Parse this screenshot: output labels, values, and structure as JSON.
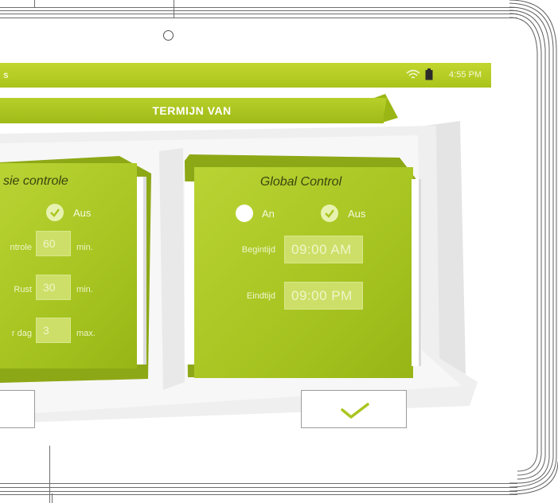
{
  "status_bar": {
    "left_text": "s",
    "time": "4:55 PM",
    "icons": [
      "wifi-icon",
      "battery-icon"
    ]
  },
  "ribbon": {
    "title": "TERMIJN VAN"
  },
  "left_card": {
    "title": "sie controle",
    "options": {
      "on_label": "",
      "off_label": "Aus",
      "selected": "Aus"
    },
    "rows": [
      {
        "label": "ntrole",
        "value": "60",
        "unit": "min."
      },
      {
        "label": "Rust",
        "value": "30",
        "unit": "min."
      },
      {
        "label": "r dag",
        "value": "3",
        "unit": "max."
      }
    ]
  },
  "right_card": {
    "title": "Global Control",
    "options": {
      "on_label": "An",
      "off_label": "Aus",
      "selected": "Aus"
    },
    "rows": [
      {
        "label": "Begintijd",
        "value": "09:00 AM"
      },
      {
        "label": "Eindtijd",
        "value": "09:00 PM"
      }
    ]
  },
  "actions": {
    "confirm_icon": "checkmark-icon"
  },
  "colors": {
    "accent": "#abc520",
    "accent_dark": "#97b616",
    "title_text": "#3b4410"
  }
}
